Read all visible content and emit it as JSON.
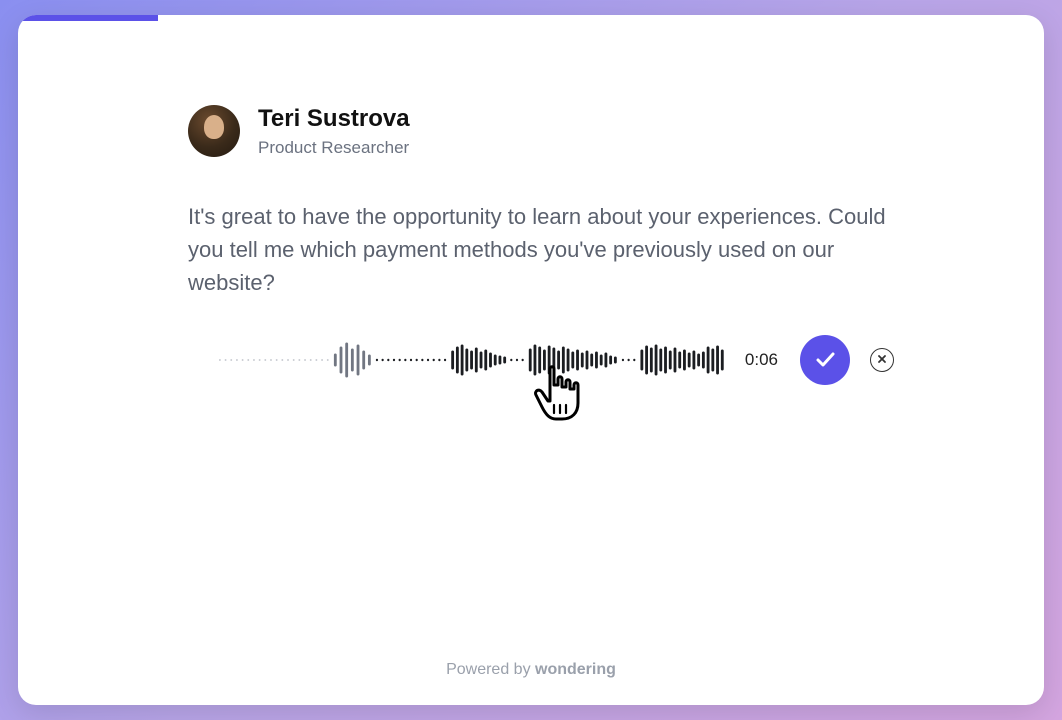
{
  "progress": {
    "percent": 14
  },
  "interviewer": {
    "name": "Teri Sustrova",
    "role": "Product Researcher"
  },
  "question": "It's great to have the opportunity to learn about your experiences. Could you tell me which payment methods you've previously used on our website?",
  "recording": {
    "timer": "0:06"
  },
  "footer": {
    "prefix": "Powered by ",
    "brand": "wondering"
  },
  "colors": {
    "accent": "#5b51e8"
  }
}
